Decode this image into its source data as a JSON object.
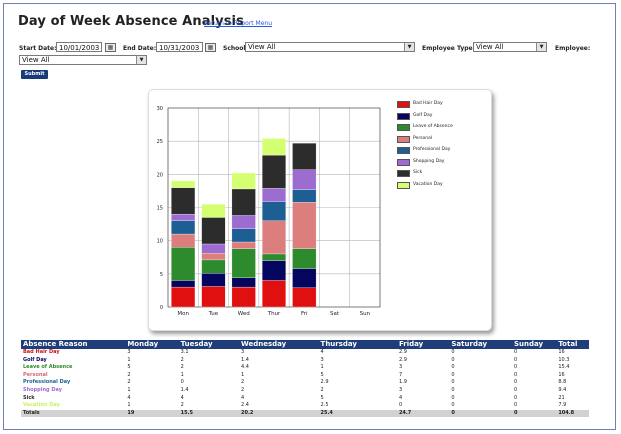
{
  "page": {
    "title": "Day of Week Absence Analysis",
    "return_link": "Return to Report Menu"
  },
  "filters": {
    "start_date_label": "Start Date:",
    "start_date_value": "10/01/2003",
    "end_date_label": "End Date:",
    "end_date_value": "10/31/2003",
    "school_label": "School:",
    "school_value": "View All",
    "employee_type_label": "Employee Type:",
    "employee_type_value": "View All",
    "employee_label": "Employee:",
    "employee_value": "View All",
    "submit_label": "Submit",
    "calendar_icon_glyph": "▦"
  },
  "chart_data": {
    "type": "bar",
    "stacked": true,
    "categories": [
      "Mon",
      "Tue",
      "Wed",
      "Thur",
      "Fri",
      "Sat",
      "Sun"
    ],
    "ylim": [
      0,
      30
    ],
    "yticks": [
      0,
      5,
      10,
      15,
      20,
      25,
      30
    ],
    "grid": true,
    "legend_position": "right",
    "series": [
      {
        "name": "Bad Hair Day",
        "color": "#e01010",
        "values": [
          3,
          3.1,
          3,
          4,
          2.9,
          0,
          0
        ]
      },
      {
        "name": "Golf Day",
        "color": "#050560",
        "values": [
          1,
          2,
          1.4,
          3,
          2.9,
          0,
          0
        ]
      },
      {
        "name": "Leave of Absence",
        "color": "#2d8a2d",
        "values": [
          5,
          2,
          4.4,
          1,
          3,
          0,
          0
        ]
      },
      {
        "name": "Personal",
        "color": "#dc7e7e",
        "values": [
          2,
          1,
          1,
          5,
          7,
          0,
          0
        ]
      },
      {
        "name": "Professional Day",
        "color": "#1d5f92",
        "values": [
          2,
          0,
          2,
          2.9,
          1.9,
          0,
          0
        ]
      },
      {
        "name": "Shopping Day",
        "color": "#9c6cd0",
        "values": [
          1,
          1.4,
          2,
          2,
          3,
          0,
          0
        ]
      },
      {
        "name": "Sick",
        "color": "#2c2c2c",
        "values": [
          4,
          4,
          4,
          5,
          4,
          0,
          0
        ]
      },
      {
        "name": "Vacation Day",
        "color": "#d4ff70",
        "values": [
          1,
          2,
          2.4,
          2.5,
          0,
          0,
          0
        ]
      }
    ]
  },
  "table": {
    "headers": [
      "Absence Reason",
      "Monday",
      "Tuesday",
      "Wednesday",
      "Thursday",
      "Friday",
      "Saturday",
      "Sunday",
      "Total"
    ],
    "rows": [
      {
        "reason": "Bad Hair Day",
        "color": "#cc1010",
        "values": [
          "3",
          "3.1",
          "3",
          "4",
          "2.9",
          "0",
          "0",
          "16"
        ]
      },
      {
        "reason": "Golf Day",
        "color": "#050560",
        "values": [
          "1",
          "2",
          "1.4",
          "3",
          "2.9",
          "0",
          "0",
          "10.3"
        ]
      },
      {
        "reason": "Leave of Absence",
        "color": "#2d8a2d",
        "values": [
          "5",
          "2",
          "4.4",
          "1",
          "3",
          "0",
          "0",
          "15.4"
        ]
      },
      {
        "reason": "Personal",
        "color": "#d46a6a",
        "values": [
          "2",
          "1",
          "1",
          "5",
          "7",
          "0",
          "0",
          "16"
        ]
      },
      {
        "reason": "Professional Day",
        "color": "#1d5f92",
        "values": [
          "2",
          "0",
          "2",
          "2.9",
          "1.9",
          "0",
          "0",
          "8.8"
        ]
      },
      {
        "reason": "Shopping Day",
        "color": "#9c6cd0",
        "values": [
          "1",
          "1.4",
          "2",
          "2",
          "3",
          "0",
          "0",
          "9.4"
        ]
      },
      {
        "reason": "Sick",
        "color": "#2c2c2c",
        "values": [
          "4",
          "4",
          "4",
          "5",
          "4",
          "0",
          "0",
          "21"
        ]
      },
      {
        "reason": "Vacation Day",
        "color": "#c8f060",
        "values": [
          "1",
          "2",
          "2.4",
          "2.5",
          "0",
          "0",
          "0",
          "7.9"
        ]
      }
    ],
    "totals": {
      "label": "Totals",
      "values": [
        "19",
        "15.5",
        "20.2",
        "25.4",
        "24.7",
        "0",
        "0",
        "104.8"
      ]
    }
  }
}
